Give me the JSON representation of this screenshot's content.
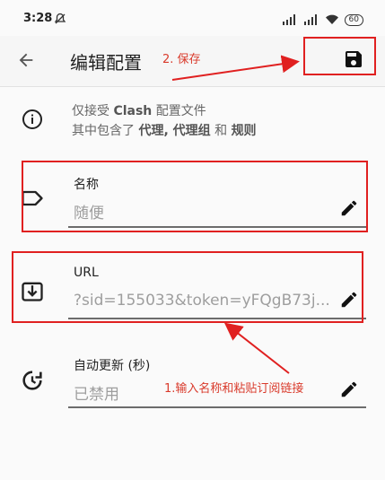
{
  "status_bar": {
    "time": "3:28",
    "battery": "60"
  },
  "app_bar": {
    "title": "编辑配置"
  },
  "info": {
    "line1_prefix": "仅接受 ",
    "line1_bold": "Clash",
    "line1_suffix": " 配置文件",
    "line2_prefix": "其中包含了 ",
    "line2_bold": "代理, 代理组",
    "line2_mid": " 和 ",
    "line2_bold2": "规则"
  },
  "fields": {
    "name": {
      "label": "名称",
      "value": "随便"
    },
    "url": {
      "label": "URL",
      "value": "?sid=155033&token=yFQgB73j..."
    },
    "auto_update": {
      "label": "自动更新 (秒)",
      "value": "已禁用"
    }
  },
  "annotations": {
    "save": "2. 保存",
    "input": "1.输入名称和粘贴订阅链接"
  },
  "colors": {
    "annotation_red": "#e02020",
    "accent_text": "#212121"
  }
}
